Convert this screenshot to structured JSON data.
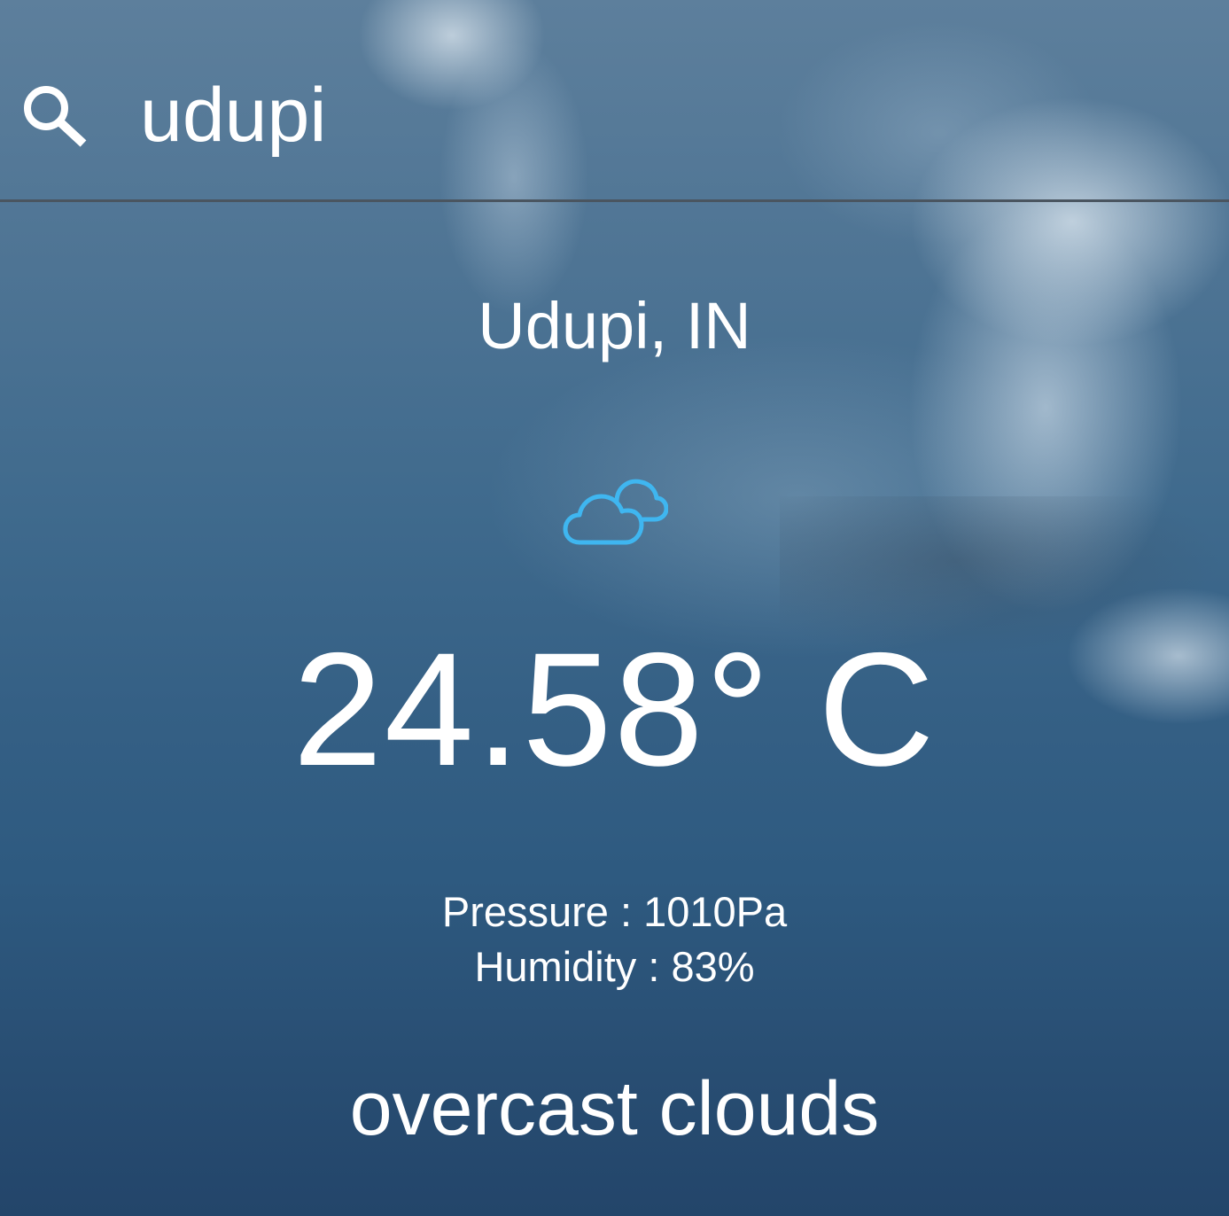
{
  "search": {
    "value": "udupi",
    "icon": "search-icon"
  },
  "location": {
    "text": "Udupi, IN"
  },
  "weather_icon": {
    "name": "cloud-icon",
    "color": "#3fb6f0"
  },
  "temperature": {
    "text": "24.58° C"
  },
  "details": {
    "pressure": "Pressure : 1010Pa",
    "humidity": "Humidity : 83%"
  },
  "description": {
    "text": "overcast clouds"
  }
}
